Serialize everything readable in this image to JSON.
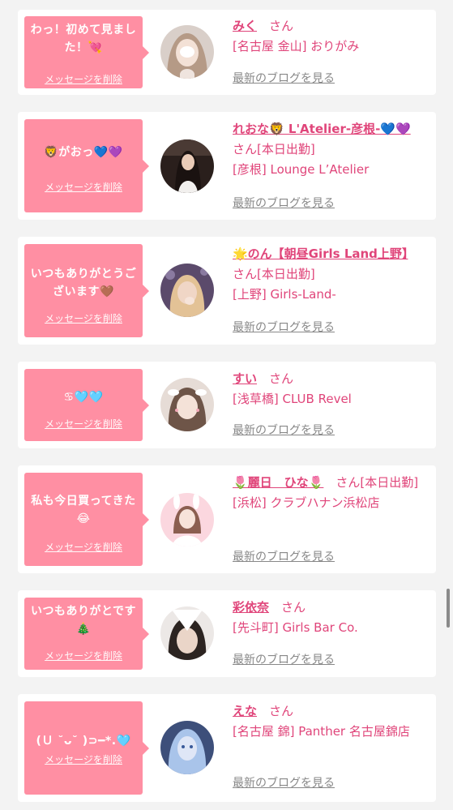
{
  "delete_label": "メッセージを削除",
  "blog_label": "最新のブログを見る",
  "san_label": "さん",
  "colors": {
    "page_bg": "#f3f3f3",
    "bubble_bg": "#ff8fa3",
    "accent": "#e0457a",
    "link_gray": "#888888"
  },
  "messages": [
    {
      "text": "わっ！初めて見ました！💘",
      "name": "みく",
      "suffix": "",
      "shop": "[名古屋 金山] おりがみ",
      "avatar_icon": "girl-face-avatar"
    },
    {
      "text": "🦁がおっ💙💜",
      "name": "れおな🦁 L'Atelier-彦根-💙💜",
      "suffix": "[本日出勤]",
      "shop": "[彦根] Lounge L’Atelier",
      "avatar_icon": "girl-dark-avatar"
    },
    {
      "text": "いつもありがとうございます🤎",
      "name": "🌟のん【朝昼Girls Land上野】",
      "suffix": "[本日出勤]",
      "shop": "[上野] Girls-Land-",
      "avatar_icon": "girl-blonde-avatar"
    },
    {
      "text": "♋︎🩵🩵",
      "name": "すい",
      "suffix": "",
      "shop": "[浅草橋] CLUB Revel",
      "avatar_icon": "girl-bunny-ears-avatar"
    },
    {
      "text": "私も今日買ってきた😂",
      "name": "🌷麗日　ひな🌷",
      "suffix": "[本日出勤]",
      "shop": "[浜松] クラブハナン浜松店",
      "avatar_icon": "girl-pink-avatar"
    },
    {
      "text": "いつもありがとです🎄",
      "name": "彩依奈",
      "suffix": "",
      "shop": "[先斗町] Girls Bar Co.",
      "avatar_icon": "girl-hidden-face-avatar"
    },
    {
      "text": "(Ｕ ˘ᴗ˘ )⊃━*.🩵",
      "name": "えな",
      "suffix": "",
      "shop": "[名古屋 錦] Panther 名古屋錦店",
      "avatar_icon": "girl-blue-avatar"
    }
  ]
}
